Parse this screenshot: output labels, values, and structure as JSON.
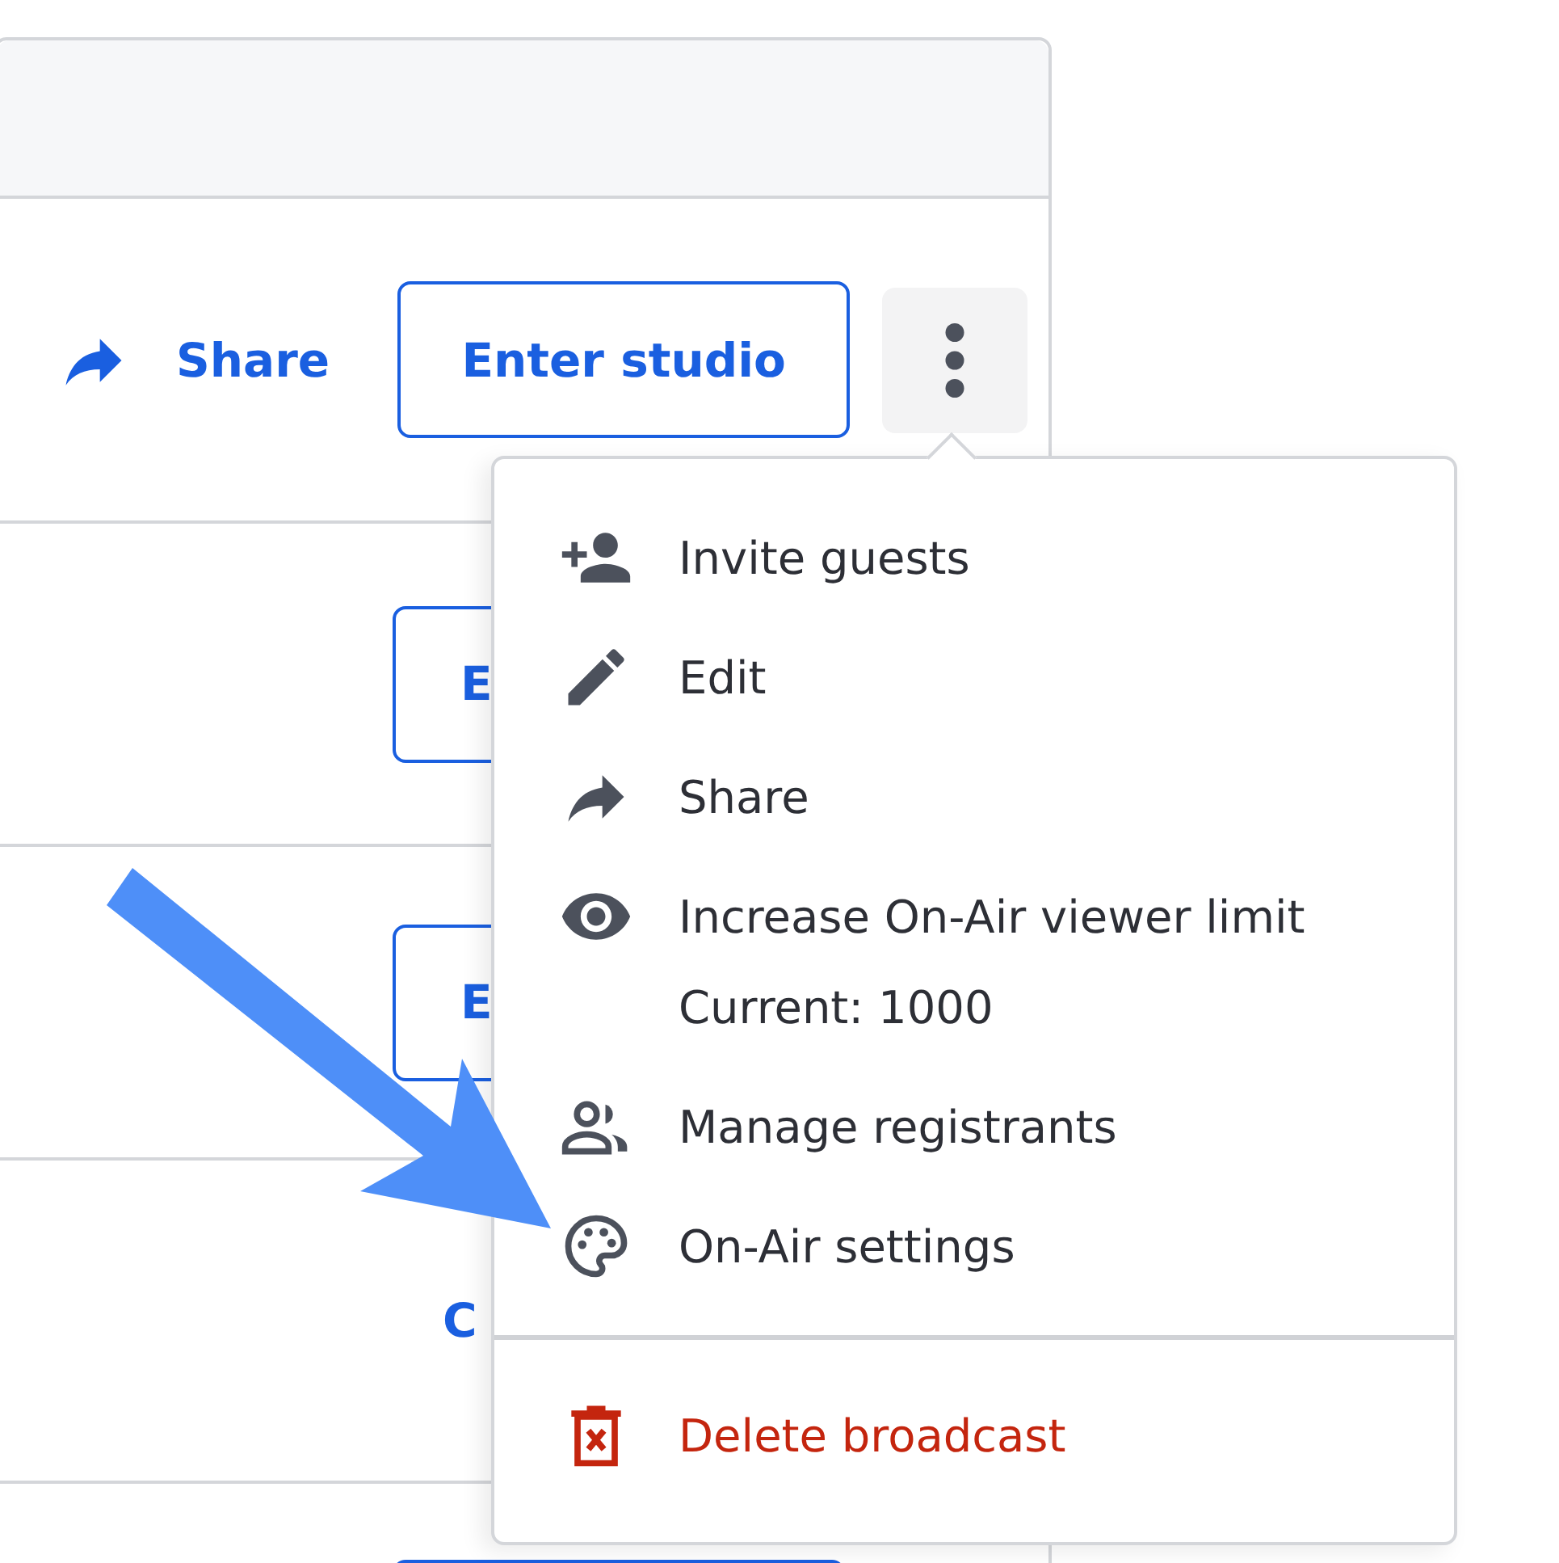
{
  "rows": [
    {
      "kind": "actions",
      "share_label": "Share",
      "button_label": "Enter studio"
    },
    {
      "kind": "button",
      "label": "E"
    },
    {
      "kind": "button",
      "label": "E"
    },
    {
      "kind": "link",
      "label": "C"
    },
    {
      "kind": "button"
    }
  ],
  "menu": {
    "open": true,
    "items": [
      {
        "kind": "invite",
        "label": "Invite guests"
      },
      {
        "kind": "edit",
        "label": "Edit"
      },
      {
        "kind": "share",
        "label": "Share"
      },
      {
        "kind": "eye",
        "label": "Increase On-Air viewer limit",
        "detail": "Current: 1000"
      },
      {
        "kind": "people",
        "label": "Manage registrants"
      },
      {
        "kind": "palette",
        "label": "On-Air settings"
      },
      {
        "kind": "delete",
        "label": "Delete broadcast",
        "danger": true
      }
    ]
  }
}
